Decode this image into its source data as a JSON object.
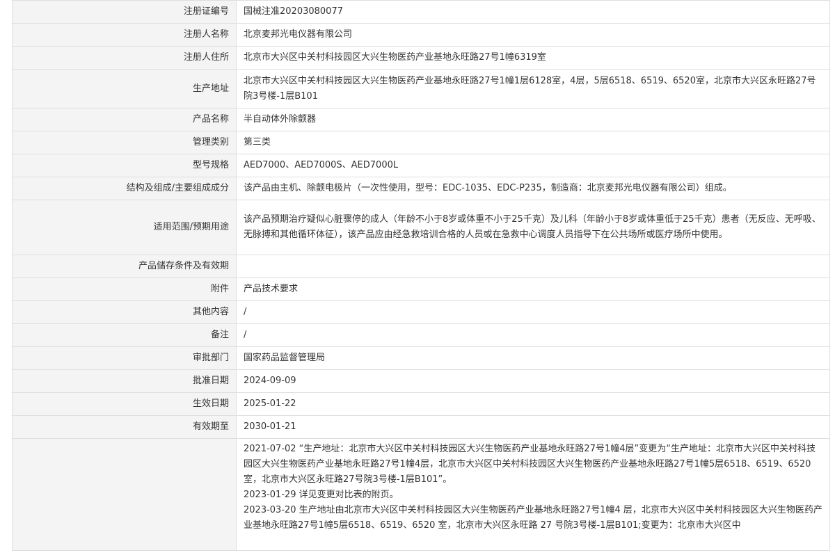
{
  "rows": [
    {
      "label": "注册证编号",
      "value": "国械注准20203080077"
    },
    {
      "label": "注册人名称",
      "value": "北京麦邦光电仪器有限公司"
    },
    {
      "label": "注册人住所",
      "value": "北京市大兴区中关村科技园区大兴生物医药产业基地永旺路27号1幢6319室"
    },
    {
      "label": "生产地址",
      "value": "北京市大兴区中关村科技园区大兴生物医药产业基地永旺路27号1幢1层6128室，4层，5层6518、6519、6520室，北京市大兴区永旺路27号院3号楼-1层B101"
    },
    {
      "label": "产品名称",
      "value": "半自动体外除颤器"
    },
    {
      "label": "管理类别",
      "value": "第三类"
    },
    {
      "label": "型号规格",
      "value": "AED7000、AED7000S、AED7000L"
    },
    {
      "label": "结构及组成/主要组成成分",
      "value": "该产品由主机、除颤电极片（一次性使用，型号：EDC-1035、EDC-P235，制造商：北京麦邦光电仪器有限公司）组成。"
    },
    {
      "label": "适用范围/预期用途",
      "value": "该产品预期治疗疑似心脏骤停的成人（年龄不小于8岁或体重不小于25千克）及儿科（年龄小于8岁或体重低于25千克）患者（无反应、无呼吸、无脉搏和其他循环体征），该产品应由经急救培训合格的人员或在急救中心调度人员指导下在公共场所或医疗场所中使用。"
    },
    {
      "label": "产品储存条件及有效期",
      "value": ""
    },
    {
      "label": "附件",
      "value": "产品技术要求"
    },
    {
      "label": "其他内容",
      "value": "/"
    },
    {
      "label": "备注",
      "value": "/"
    },
    {
      "label": "审批部门",
      "value": "国家药品监督管理局"
    },
    {
      "label": "批准日期",
      "value": "2024-09-09"
    },
    {
      "label": "生效日期",
      "value": "2025-01-22"
    },
    {
      "label": "有效期至",
      "value": "2030-01-21"
    }
  ],
  "changes": {
    "label": "",
    "entries": [
      "2021-07-02 “生产地址：北京市大兴区中关村科技园区大兴生物医药产业基地永旺路27号1幢4层”变更为“生产地址：北京市大兴区中关村科技园区大兴生物医药产业基地永旺路27号1幢4层，北京市大兴区中关村科技园区大兴生物医药产业基地永旺路27号1幢5层6518、6519、6520室，北京市大兴区永旺路27号院3号楼-1层B101”。",
      "2023-01-29 详见变更对比表的附页。",
      "2023-03-20 生产地址由北京市大兴区中关村科技园区大兴生物医药产业基地永旺路27号1幢4 层，北京市大兴区中关村科技园区大兴生物医药产业基地永旺路27号1幢5层6518、6519、6520 室，北京市大兴区永旺路 27 号院3号楼-1层B101;变更为：北京市大兴区中"
    ]
  }
}
